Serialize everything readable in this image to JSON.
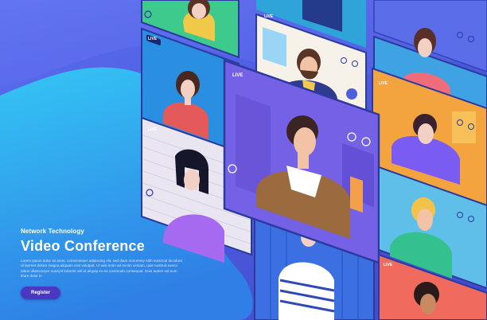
{
  "hero": {
    "subtitle": "Network Technology",
    "title": "Video Conference",
    "body": "Lorem ipsum dolor sit amet, consectetuer adipiscing elit, sed diam nonummy nibh euismod tincidunt ut laoreet dolore magna aliquam erat volutpat. Ut wisi enim ad minim veniam, quis nostrud exerci tation ullamcorper suscipit lobortis nisl ut aliquip ex ea commodo consequat. Duis autem vel eum iriure dolor in",
    "register_label": "Register"
  },
  "badges": {
    "live": "LIVE"
  },
  "colors": {
    "background": "#4f5fe0",
    "blob": "#2bb4f0",
    "button": "#4a37c2",
    "text": "#ffffff"
  }
}
